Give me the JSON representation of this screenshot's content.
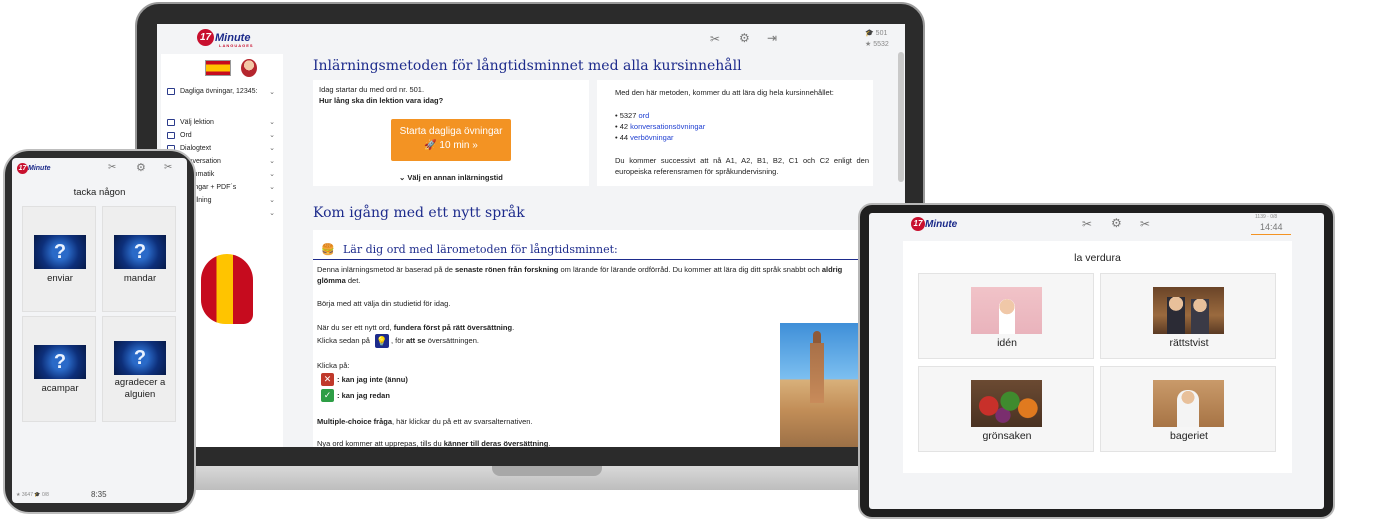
{
  "brand": {
    "logo_number": "17",
    "logo_word": "Minute",
    "logo_sub": "LANGUAGES"
  },
  "laptop": {
    "stats": {
      "words": "501",
      "stars": "5532"
    },
    "sidebar": {
      "daily": "Dagliga övningar, 12345:",
      "items": [
        {
          "label": "Välj lektion"
        },
        {
          "label": "Ord"
        },
        {
          "label": "Dialogtext"
        },
        {
          "label": "Konversation"
        },
        {
          "label": "Grammatik"
        },
        {
          "label": "Övningar + PDF´s"
        },
        {
          "label": "Inställning"
        },
        {
          "label": ""
        }
      ]
    },
    "main": {
      "title": "Inlärningsmetoden för långtidsminnet med alla kursinnehåll",
      "left_card": {
        "line1": "Idag startar du med ord nr. 501.",
        "line2": "Hur lång ska din lektion vara idag?",
        "button_line1": "Starta dagliga övningar",
        "button_line2": "🚀 10 min  »",
        "choose": "Välj en annan inlärningstid"
      },
      "right_card": {
        "intro": "Med den här metoden, kommer du att lära dig hela kursinnehållet:",
        "b1_num": "5327",
        "b1_link": "ord",
        "b2_num": "42",
        "b2_link": "konversationsövningar",
        "b3_num": "44",
        "b3_link": "verbövningar",
        "outro": "Du kommer successivt att nå A1, A2, B1, B2, C1 och C2 enligt den europeiska referensramen för språkundervisning."
      },
      "section2_title": "Kom igång med ett nytt språk",
      "lesson": {
        "heading": "Lär dig ord med lärometoden för långtidsminnet:",
        "p1a": "Denna inlärningsmetod är baserad på de ",
        "p1b": "senaste rönen från forskning",
        "p1c": " om lärande för lärande ordförråd. Du kommer att lära dig ditt språk snabbt och ",
        "p1d": "aldrig",
        "p1e": "glömma",
        "p1f": " det.",
        "p2": "Börja med att välja din studietid för idag.",
        "p3a": "När du ser ett nytt ord, ",
        "p3b": "fundera först på rätt översättning",
        "p3c": ".",
        "p4a": "Klicka sedan på",
        "p4b": ", för ",
        "p4c": "att se",
        "p4d": " översättningen.",
        "p5": "Klicka på:",
        "p6": ": kan jag inte (ännu)",
        "p7": ": kan jag redan",
        "p8a": "Multiple-choice fråga",
        "p8b": ", här klickar du på ett av svarsalternativen.",
        "p9a": "Nya ord kommer att upprepas, tills du ",
        "p9b": "känner till deras översättning",
        "p9c": "."
      }
    }
  },
  "phone": {
    "prompt": "tacka någon",
    "tiles": [
      {
        "label": "enviar"
      },
      {
        "label": "mandar"
      },
      {
        "label": "acampar"
      },
      {
        "label": "agradecer a alguien"
      }
    ],
    "stats_left": "3647",
    "stats_right": "0/8",
    "timer": "8:35"
  },
  "tablet": {
    "prompt": "la verdura",
    "tiles": [
      {
        "label": "idén"
      },
      {
        "label": "rättstvist"
      },
      {
        "label": "grönsaken"
      },
      {
        "label": "bageriet"
      }
    ],
    "stats": "1139 · 0/8",
    "timer": "14:44"
  },
  "colors": {
    "accent_orange": "#f39323",
    "brand_blue": "#1d2b8c",
    "brand_red": "#c8102e"
  }
}
